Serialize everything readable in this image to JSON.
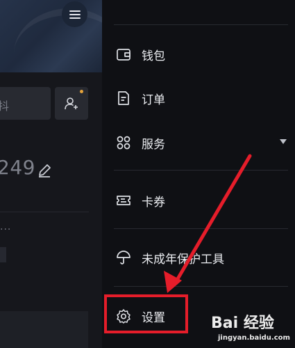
{
  "background_panel": {
    "search_fragment": "抖",
    "user_number": "249",
    "ellipsis": "..."
  },
  "menu": {
    "items": [
      {
        "label": "钱包",
        "icon": "wallet-icon"
      },
      {
        "label": "订单",
        "icon": "order-icon"
      },
      {
        "label": "服务",
        "icon": "services-icon",
        "expandable": true
      },
      {
        "label": "卡券",
        "icon": "coupon-icon"
      },
      {
        "label": "未成年保护工具",
        "icon": "umbrella-icon"
      },
      {
        "label": "设置",
        "icon": "gear-icon"
      }
    ]
  },
  "annotation": {
    "color": "#e51d2a",
    "highlighted_item": "设置"
  },
  "watermark": {
    "brand": "Bai 经验",
    "url": "jingyan.baidu.com"
  },
  "colors": {
    "drawer_bg": "#0f1014",
    "text": "#eceef2",
    "divider": "#282a31",
    "notify_dot": "#e5a33b"
  }
}
